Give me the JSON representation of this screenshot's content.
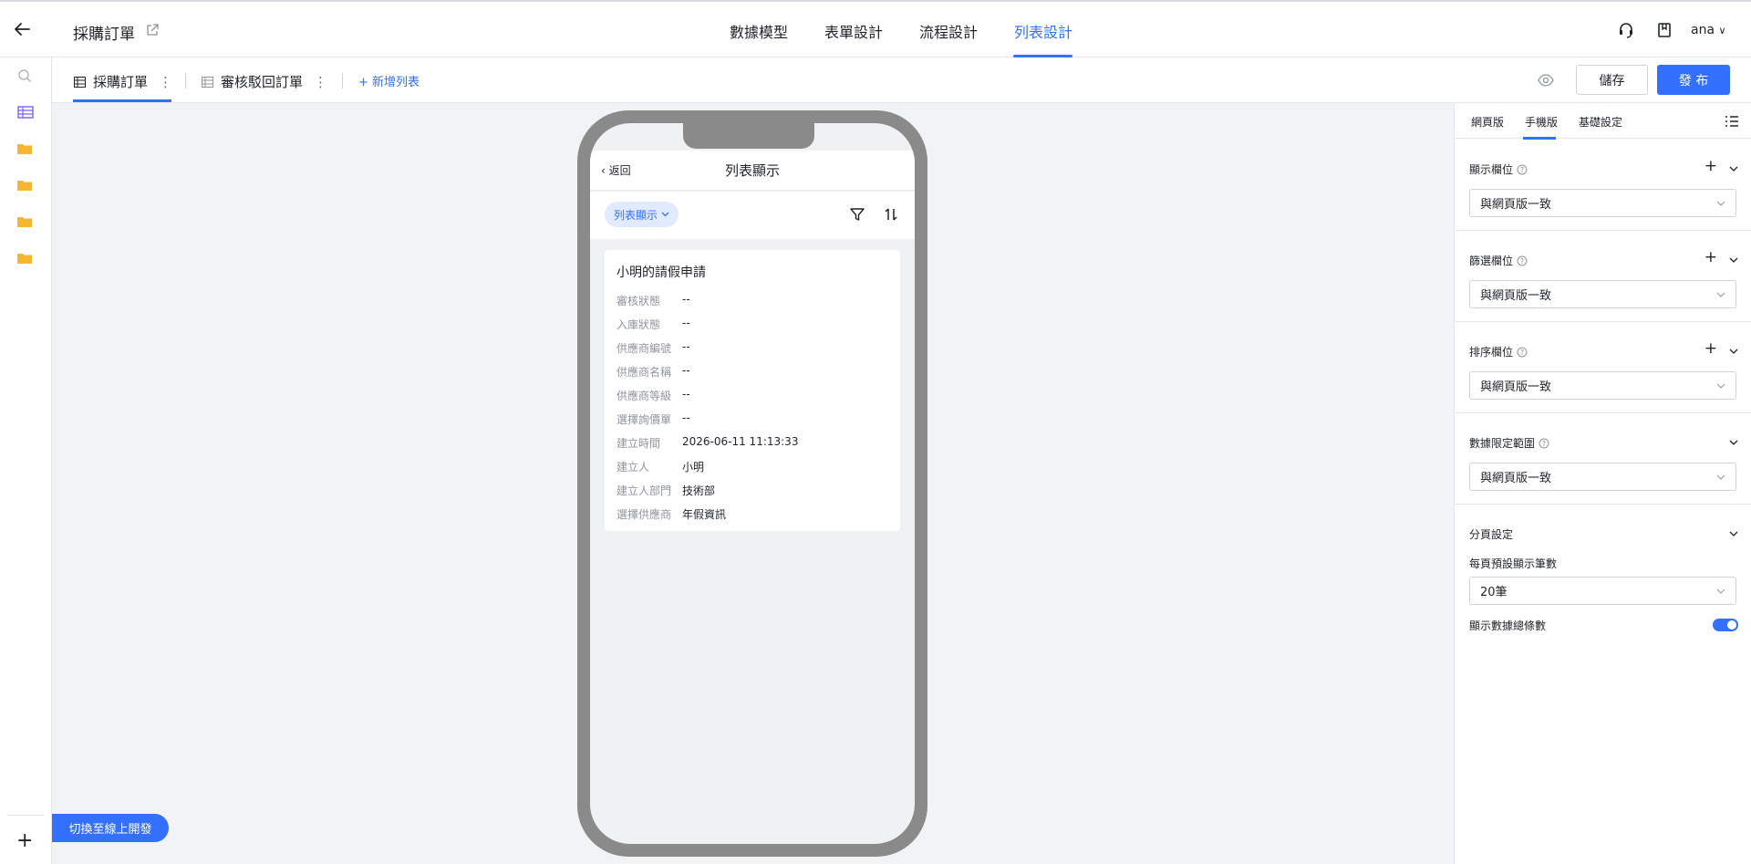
{
  "app": {
    "title": "採購訂單",
    "back_icon": "arrow-left-icon",
    "external_icon": "external-link-icon"
  },
  "nav": {
    "tabs": [
      {
        "label": "數據模型"
      },
      {
        "label": "表單設計"
      },
      {
        "label": "流程設計"
      },
      {
        "label": "列表設計"
      }
    ],
    "active": "列表設計"
  },
  "user": {
    "name": "ana",
    "support_icon": "headset-icon",
    "docs_icon": "book-icon"
  },
  "sidebar": {
    "icons": [
      "search-icon",
      "table-icon",
      "folder-icon",
      "folder-icon",
      "folder-icon",
      "folder-icon"
    ],
    "add_label": "+",
    "switch_label": "切換至線上開發"
  },
  "subbar": {
    "lists": [
      {
        "label": "採購訂單"
      },
      {
        "label": "審核駁回訂單"
      }
    ],
    "new_list": "+ 新增列表",
    "save": "儲存",
    "publish": "發 布"
  },
  "phone": {
    "back": "返回",
    "title": "列表顯示",
    "view_chip": "列表顯示",
    "card": {
      "title": "小明的請假申請",
      "fields": [
        {
          "k": "審核狀態",
          "v": "--"
        },
        {
          "k": "入庫狀態",
          "v": "--"
        },
        {
          "k": "供應商編號",
          "v": "--"
        },
        {
          "k": "供應商名稱",
          "v": "--"
        },
        {
          "k": "供應商等級",
          "v": "--"
        },
        {
          "k": "選擇詢價單",
          "v": "--"
        },
        {
          "k": "建立時間",
          "v": "2026-06-11 11:13:33"
        },
        {
          "k": "建立人",
          "v": "小明"
        },
        {
          "k": "建立人部門",
          "v": "技術部"
        },
        {
          "k": "選擇供應商",
          "v": "年假資訊"
        }
      ]
    }
  },
  "panel": {
    "tabs": [
      "網頁版",
      "手機版",
      "基礎設定"
    ],
    "active_tab": "手機版",
    "sections": {
      "display": {
        "title": "顯示欄位",
        "value": "與網頁版一致"
      },
      "filter": {
        "title": "篩選欄位",
        "value": "與網頁版一致"
      },
      "sort": {
        "title": "排序欄位",
        "value": "與網頁版一致"
      },
      "scope": {
        "title": "數據限定範圍",
        "value": "與網頁版一致"
      },
      "paging": {
        "title": "分頁設定",
        "per_page_label": "每頁預設顯示筆數",
        "per_page_value": "20筆",
        "show_total_label": "顯示數據總條數",
        "show_total_on": true
      }
    },
    "accent": "#3370ff"
  }
}
